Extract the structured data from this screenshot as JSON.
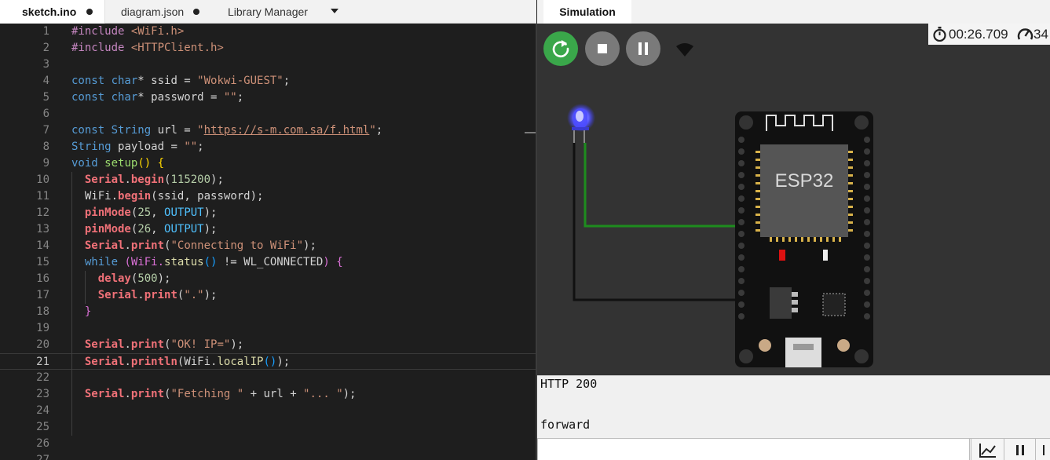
{
  "editor": {
    "tabs": [
      {
        "label": "sketch.ino",
        "active": true,
        "unsaved": true
      },
      {
        "label": "diagram.json",
        "active": false,
        "unsaved": true
      },
      {
        "label": "Library Manager",
        "active": false,
        "unsaved": false
      }
    ],
    "current_line": 21,
    "lines": [
      [
        {
          "t": "#include ",
          "c": "inc"
        },
        {
          "t": "<WiFi.h>",
          "c": "hdr"
        }
      ],
      [
        {
          "t": "#include ",
          "c": "inc"
        },
        {
          "t": "<HTTPClient.h>",
          "c": "hdr"
        }
      ],
      [],
      [
        {
          "t": "const ",
          "c": "kw"
        },
        {
          "t": "char",
          "c": "kw"
        },
        {
          "t": "* ssid = "
        },
        {
          "t": "\"Wokwi-GUEST\"",
          "c": "str"
        },
        {
          "t": ";"
        }
      ],
      [
        {
          "t": "const ",
          "c": "kw"
        },
        {
          "t": "char",
          "c": "kw"
        },
        {
          "t": "* password = "
        },
        {
          "t": "\"\"",
          "c": "str"
        },
        {
          "t": ";"
        }
      ],
      [],
      [
        {
          "t": "const ",
          "c": "kw"
        },
        {
          "t": "String ",
          "c": "kw"
        },
        {
          "t": "url = "
        },
        {
          "t": "\"",
          "c": "str"
        },
        {
          "t": "https://s-m.com.sa/f.html",
          "c": "url"
        },
        {
          "t": "\"",
          "c": "str"
        },
        {
          "t": ";"
        }
      ],
      [
        {
          "t": "String ",
          "c": "kw"
        },
        {
          "t": "payload = "
        },
        {
          "t": "\"\"",
          "c": "str"
        },
        {
          "t": ";"
        }
      ],
      [
        {
          "t": "void ",
          "c": "kw"
        },
        {
          "t": "setup",
          "c": "fn2"
        },
        {
          "t": "()",
          "c": "br"
        },
        {
          "t": " "
        },
        {
          "t": "{",
          "c": "br"
        }
      ],
      [
        {
          "t": "  "
        },
        {
          "t": "Serial",
          "c": "ser"
        },
        {
          "t": "."
        },
        {
          "t": "begin",
          "c": "ser"
        },
        {
          "t": "("
        },
        {
          "t": "115200",
          "c": "num"
        },
        {
          "t": ");"
        }
      ],
      [
        {
          "t": "  WiFi."
        },
        {
          "t": "begin",
          "c": "ser"
        },
        {
          "t": "(ssid, password);"
        }
      ],
      [
        {
          "t": "  "
        },
        {
          "t": "pinMode",
          "c": "ser"
        },
        {
          "t": "("
        },
        {
          "t": "25",
          "c": "num"
        },
        {
          "t": ", "
        },
        {
          "t": "OUTPUT",
          "c": "mac"
        },
        {
          "t": ");"
        }
      ],
      [
        {
          "t": "  "
        },
        {
          "t": "pinMode",
          "c": "ser"
        },
        {
          "t": "("
        },
        {
          "t": "26",
          "c": "num"
        },
        {
          "t": ", "
        },
        {
          "t": "OUTPUT",
          "c": "mac"
        },
        {
          "t": ");"
        }
      ],
      [
        {
          "t": "  "
        },
        {
          "t": "Serial",
          "c": "ser"
        },
        {
          "t": "."
        },
        {
          "t": "print",
          "c": "ser"
        },
        {
          "t": "("
        },
        {
          "t": "\"Connecting to WiFi\"",
          "c": "str"
        },
        {
          "t": ");"
        }
      ],
      [
        {
          "t": "  "
        },
        {
          "t": "while ",
          "c": "kw"
        },
        {
          "t": "(WiFi.",
          "c": "br2"
        },
        {
          "t": "status",
          "c": "fn"
        },
        {
          "t": "()",
          "c": "br3"
        },
        {
          "t": " != WL_CONNECTED"
        },
        {
          "t": ")",
          "c": "br2"
        },
        {
          "t": " "
        },
        {
          "t": "{",
          "c": "br2"
        }
      ],
      [
        {
          "t": "    "
        },
        {
          "t": "delay",
          "c": "ser"
        },
        {
          "t": "("
        },
        {
          "t": "500",
          "c": "num"
        },
        {
          "t": ");"
        }
      ],
      [
        {
          "t": "    "
        },
        {
          "t": "Serial",
          "c": "ser"
        },
        {
          "t": "."
        },
        {
          "t": "print",
          "c": "ser"
        },
        {
          "t": "("
        },
        {
          "t": "\".\"",
          "c": "str"
        },
        {
          "t": ");"
        }
      ],
      [
        {
          "t": "  "
        },
        {
          "t": "}",
          "c": "br2"
        }
      ],
      [],
      [
        {
          "t": "  "
        },
        {
          "t": "Serial",
          "c": "ser"
        },
        {
          "t": "."
        },
        {
          "t": "print",
          "c": "ser"
        },
        {
          "t": "("
        },
        {
          "t": "\"OK! IP=\"",
          "c": "str"
        },
        {
          "t": ");"
        }
      ],
      [
        {
          "t": "  "
        },
        {
          "t": "Serial",
          "c": "ser"
        },
        {
          "t": "."
        },
        {
          "t": "println",
          "c": "ser"
        },
        {
          "t": "(WiFi."
        },
        {
          "t": "localIP",
          "c": "fn"
        },
        {
          "t": "()",
          "c": "br3"
        },
        {
          "t": ");"
        }
      ],
      [],
      [
        {
          "t": "  "
        },
        {
          "t": "Serial",
          "c": "ser"
        },
        {
          "t": "."
        },
        {
          "t": "print",
          "c": "ser"
        },
        {
          "t": "("
        },
        {
          "t": "\"Fetching \"",
          "c": "str"
        },
        {
          "t": " + url + "
        },
        {
          "t": "\"... \"",
          "c": "str"
        },
        {
          "t": ");"
        }
      ],
      [],
      [],
      [],
      []
    ]
  },
  "simulation": {
    "tab_label": "Simulation",
    "timer": "00:26.709",
    "speed": "34",
    "board_label": "ESP32",
    "led_color": "#3b3bff",
    "wire_green": "#1e8c1e",
    "serial_output": [
      "HTTP 200",
      "",
      "forward"
    ],
    "serial_input_value": ""
  },
  "icons": {
    "restart": "restart-icon",
    "stop": "stop-icon",
    "pause": "pause-icon",
    "wifi": "wifi-icon",
    "stopwatch": "stopwatch-icon",
    "gauge": "gauge-icon",
    "plotter": "plotter-icon"
  }
}
